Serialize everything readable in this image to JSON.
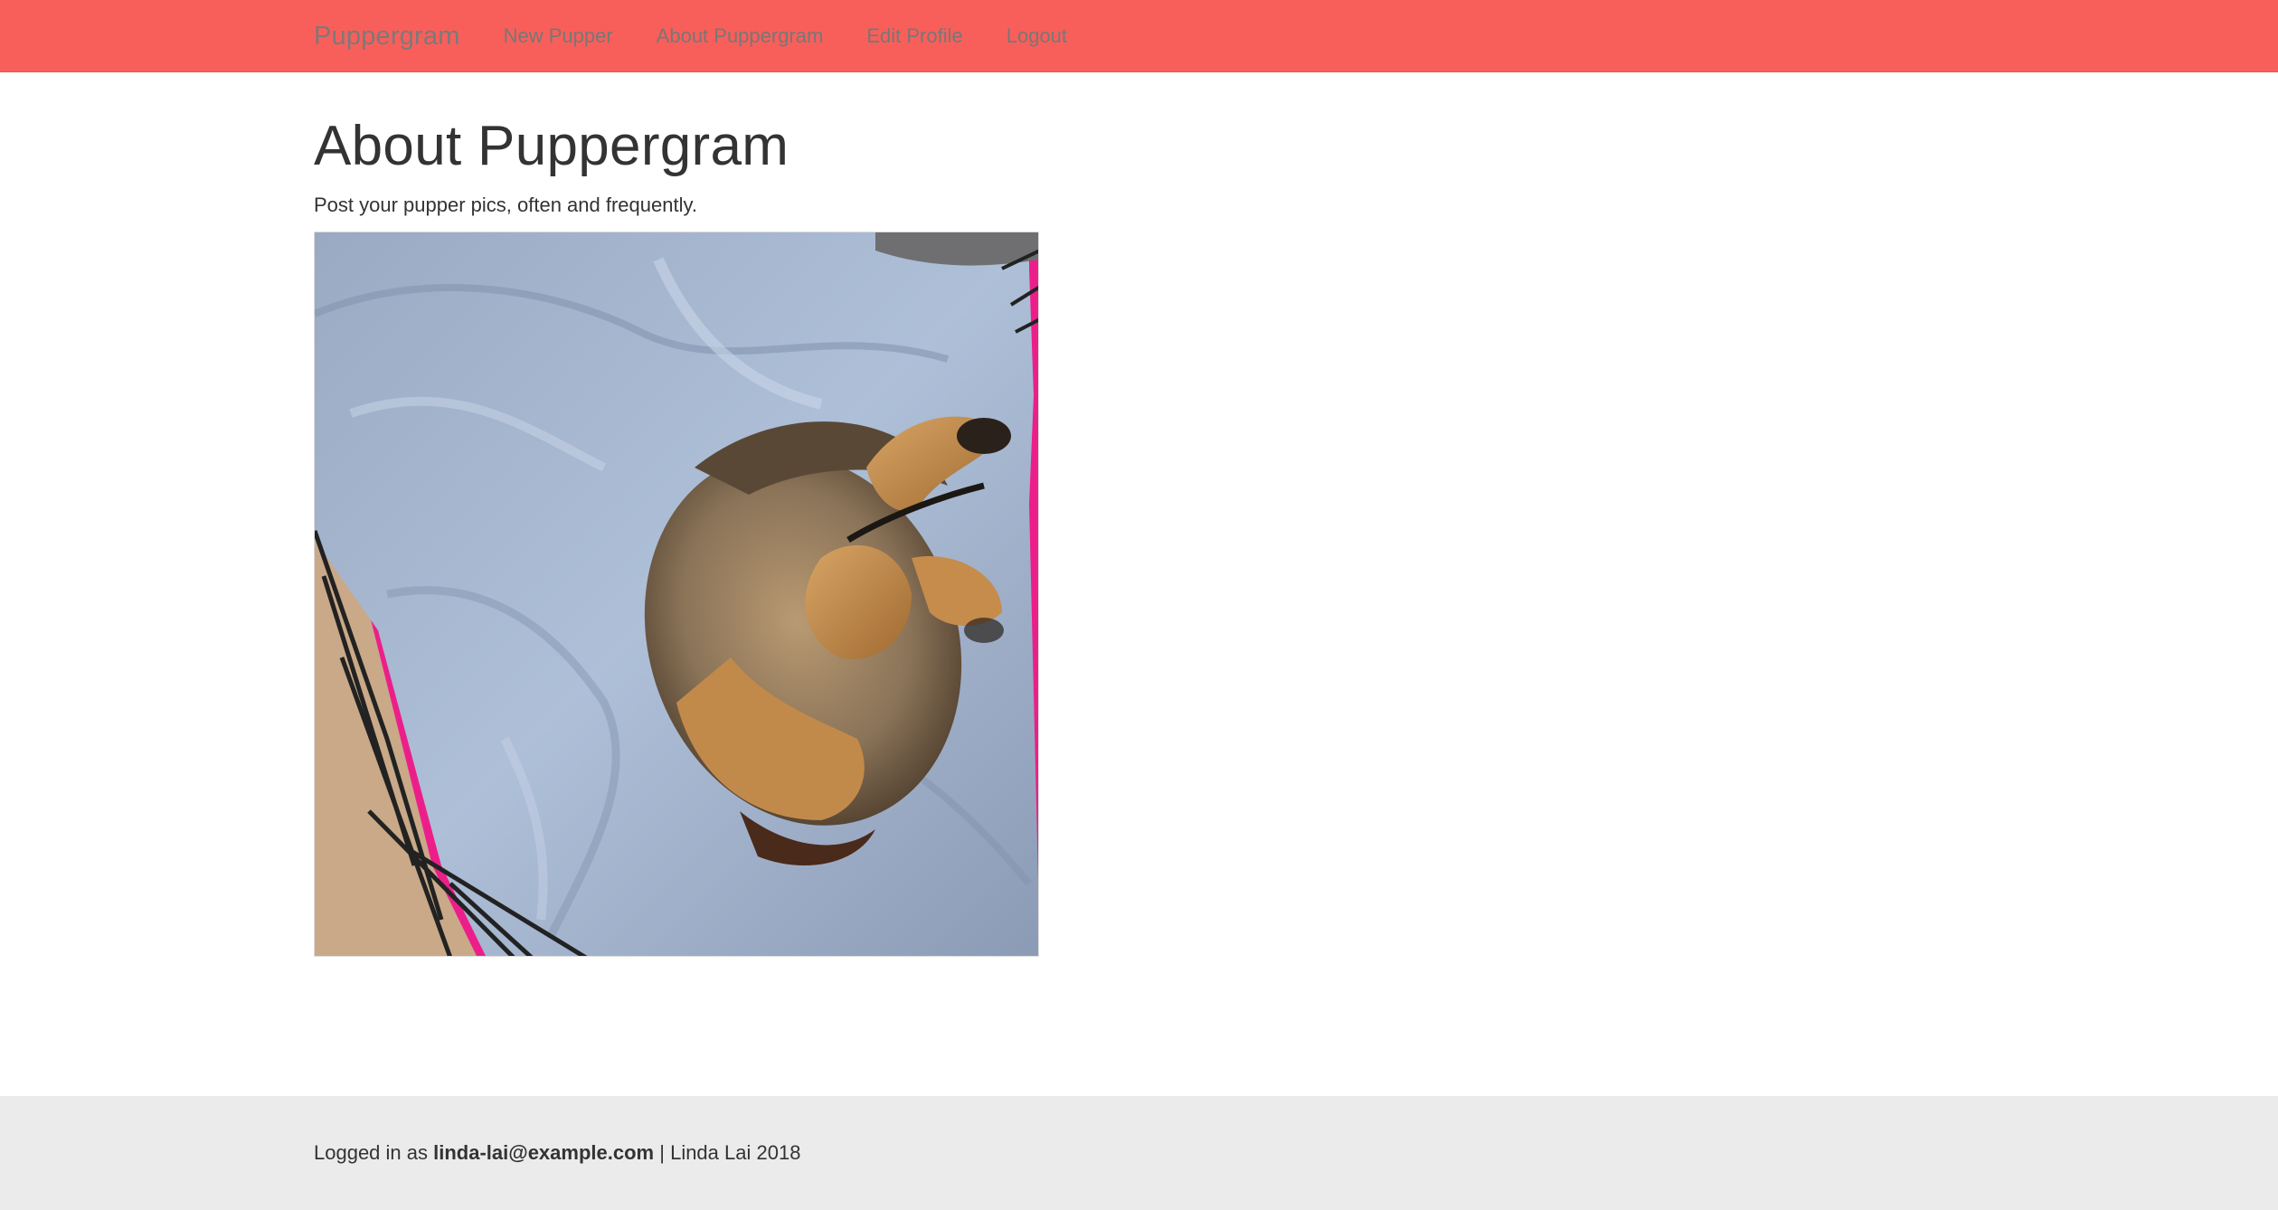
{
  "navbar": {
    "brand": "Puppergram",
    "links": [
      {
        "label": "New Pupper"
      },
      {
        "label": "About Puppergram"
      },
      {
        "label": "Edit Profile"
      },
      {
        "label": "Logout"
      }
    ],
    "background_color": "#f95f5a"
  },
  "main": {
    "title": "About Puppergram",
    "description": "Post your pupper pics, often and frequently."
  },
  "footer": {
    "prefix": "Logged in as",
    "user_email": "linda-lai@example.com",
    "separator": "|",
    "credit": "Linda Lai 2018",
    "background_color": "#ebebeb"
  }
}
